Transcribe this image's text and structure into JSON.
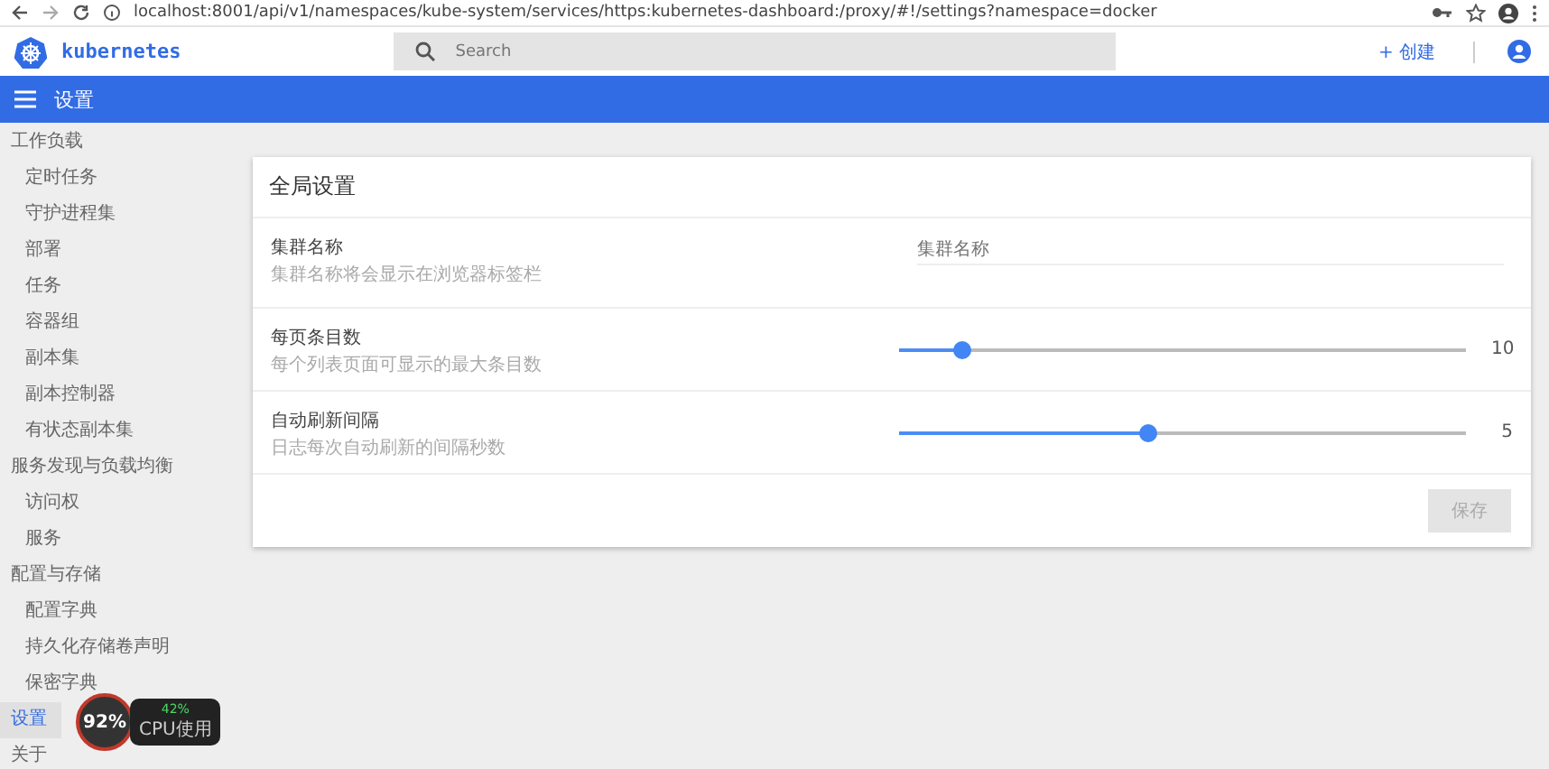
{
  "browser": {
    "url": "localhost:8001/api/v1/namespaces/kube-system/services/https:kubernetes-dashboard:/proxy/#!/settings?namespace=docker"
  },
  "header": {
    "brand": "kubernetes",
    "search": {
      "placeholder": "Search"
    },
    "create_button": "+ 创建"
  },
  "toolbar": {
    "title": "设置"
  },
  "sidebar": {
    "items": [
      {
        "label": "工作负载",
        "selected": false,
        "children": [
          {
            "label": "定时任务",
            "selected": false
          },
          {
            "label": "守护进程集",
            "selected": false
          },
          {
            "label": "部署",
            "selected": false
          },
          {
            "label": "任务",
            "selected": false
          },
          {
            "label": "容器组",
            "selected": false
          },
          {
            "label": "副本集",
            "selected": false
          },
          {
            "label": "副本控制器",
            "selected": false
          },
          {
            "label": "有状态副本集",
            "selected": false
          }
        ]
      },
      {
        "label": "服务发现与负载均衡",
        "selected": false,
        "children": [
          {
            "label": "访问权",
            "selected": false
          },
          {
            "label": "服务",
            "selected": false
          }
        ]
      },
      {
        "label": "配置与存储",
        "selected": false,
        "children": [
          {
            "label": "配置字典",
            "selected": false
          },
          {
            "label": "持久化存储卷声明",
            "selected": false
          },
          {
            "label": "保密字典",
            "selected": false
          }
        ]
      },
      {
        "label": "设置",
        "selected": true
      },
      {
        "label": "关于",
        "selected": false
      }
    ]
  },
  "card": {
    "title": "全局设置",
    "settings": [
      {
        "kind": "text",
        "label": "集群名称",
        "description": "集群名称将会显示在浏览器标签栏",
        "placeholder": "集群名称"
      },
      {
        "kind": "slider",
        "label": "每页条目数",
        "description": "每个列表页面可显示的最大条目数",
        "level": 0.11,
        "reading": "10"
      },
      {
        "kind": "slider",
        "label": "自动刷新间隔",
        "description": "日志每次自动刷新的间隔秒数",
        "level": 0.44,
        "reading": "5"
      }
    ],
    "save_button": {
      "label": "保存",
      "disabled": true
    }
  },
  "cpu_widget": {
    "usage": "92%",
    "secondary": "42%",
    "caption": "CPU使用"
  }
}
